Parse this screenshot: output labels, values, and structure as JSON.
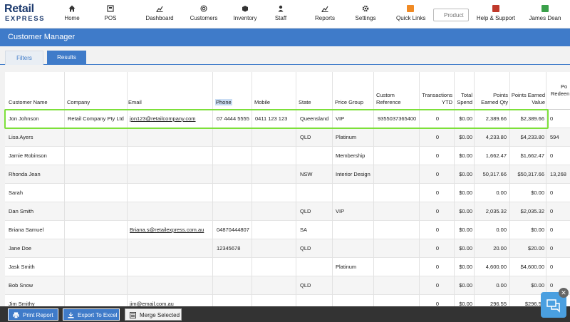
{
  "logo": {
    "line1": "Retail",
    "line2": "EXPRESS"
  },
  "nav": {
    "home": "Home",
    "pos": "POS",
    "dashboard": "Dashboard",
    "customers": "Customers",
    "inventory": "Inventory",
    "staff": "Staff",
    "reports": "Reports",
    "settings": "Settings",
    "quick_links": "Quick Links",
    "help": "Help & Support",
    "user": "James Dean",
    "search_placeholder": "Product"
  },
  "title": "Customer Manager",
  "tabs": {
    "filters": "Filters",
    "results": "Results"
  },
  "columns": {
    "customer_name": "Customer Name",
    "company": "Company",
    "email": "Email",
    "phone": "Phone",
    "mobile": "Mobile",
    "state": "State",
    "price_group": "Price Group",
    "custom_ref_1": "Custom",
    "custom_ref_2": "Reference",
    "trans_1": "Transactions",
    "trans_2": "YTD",
    "spend_1": "Total",
    "spend_2": "Spend",
    "pts_qty_1": "Points",
    "pts_qty_2": "Earned Qty",
    "pts_val_1": "Points Earned",
    "pts_val_2": "Value",
    "redeem_1": "Po",
    "redeem_2": "Redeen"
  },
  "rows": [
    {
      "name": "Jon Johnson",
      "company": "Retail Company Pty Ltd",
      "email": "jon123@retailcompany.com",
      "phone": "07 4444 5555",
      "mobile": "0411 123 123",
      "state": "Queensland",
      "price_group": "VIP",
      "custom_ref": "9355037365400",
      "trans": "0",
      "spend": "$0.00",
      "pts_qty": "2,389.66",
      "pts_val": "$2,389.66",
      "redeem": "0"
    },
    {
      "name": "Lisa Ayers",
      "company": "",
      "email": "",
      "phone": "",
      "mobile": "",
      "state": "QLD",
      "price_group": "Platinum",
      "custom_ref": "",
      "trans": "0",
      "spend": "$0.00",
      "pts_qty": "4,233.80",
      "pts_val": "$4,233.80",
      "redeem": "594"
    },
    {
      "name": "Jamie Robinson",
      "company": "",
      "email": "",
      "phone": "",
      "mobile": "",
      "state": "",
      "price_group": "Membership",
      "custom_ref": "",
      "trans": "0",
      "spend": "$0.00",
      "pts_qty": "1,662.47",
      "pts_val": "$1,662.47",
      "redeem": "0"
    },
    {
      "name": "Rhonda Jean",
      "company": "",
      "email": "",
      "phone": "",
      "mobile": "",
      "state": "NSW",
      "price_group": "Interior Design",
      "custom_ref": "",
      "trans": "0",
      "spend": "$0.00",
      "pts_qty": "50,317.66",
      "pts_val": "$50,317.66",
      "redeem": "13,268"
    },
    {
      "name": "Sarah",
      "company": "",
      "email": "",
      "phone": "",
      "mobile": "",
      "state": "",
      "price_group": "",
      "custom_ref": "",
      "trans": "0",
      "spend": "$0.00",
      "pts_qty": "0.00",
      "pts_val": "$0.00",
      "redeem": "0"
    },
    {
      "name": "Dan Smith",
      "company": "",
      "email": "",
      "phone": "",
      "mobile": "",
      "state": "QLD",
      "price_group": "VIP",
      "custom_ref": "",
      "trans": "0",
      "spend": "$0.00",
      "pts_qty": "2,035.32",
      "pts_val": "$2,035.32",
      "redeem": "0"
    },
    {
      "name": "Briana Samuel",
      "company": "",
      "email": "Briana.s@retailexpress.com.au",
      "phone": "04870444807",
      "mobile": "",
      "state": "SA",
      "price_group": "",
      "custom_ref": "",
      "trans": "0",
      "spend": "$0.00",
      "pts_qty": "0.00",
      "pts_val": "$0.00",
      "redeem": "0"
    },
    {
      "name": "Jane Doe",
      "company": "",
      "email": "",
      "phone": "12345678",
      "mobile": "",
      "state": "QLD",
      "price_group": "",
      "custom_ref": "",
      "trans": "0",
      "spend": "$0.00",
      "pts_qty": "20.00",
      "pts_val": "$20.00",
      "redeem": "0"
    },
    {
      "name": "Jask Smith",
      "company": "",
      "email": "",
      "phone": "",
      "mobile": "",
      "state": "",
      "price_group": "Platinum",
      "custom_ref": "",
      "trans": "0",
      "spend": "$0.00",
      "pts_qty": "4,600.00",
      "pts_val": "$4,600.00",
      "redeem": "0"
    },
    {
      "name": "Bob Snow",
      "company": "",
      "email": "",
      "phone": "",
      "mobile": "",
      "state": "QLD",
      "price_group": "",
      "custom_ref": "",
      "trans": "0",
      "spend": "$0.00",
      "pts_qty": "0.00",
      "pts_val": "$0.00",
      "redeem": "0"
    },
    {
      "name": "Jim Smithy",
      "company": "",
      "email": "jim@email.com.au",
      "phone": "",
      "mobile": "",
      "state": "",
      "price_group": "",
      "custom_ref": "",
      "trans": "0",
      "spend": "$0.00",
      "pts_qty": "296.55",
      "pts_val": "$296.55",
      "redeem": ""
    }
  ],
  "footer": {
    "print": "Print Report",
    "export": "Export To Excel",
    "merge": "Merge Selected"
  },
  "colors": {
    "primary": "#3f7bc9",
    "highlight": "#7de03a",
    "footer_bg": "#333333"
  }
}
